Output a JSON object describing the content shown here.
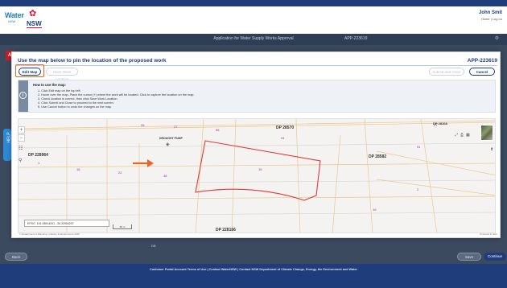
{
  "header": {
    "logo_water": "Water",
    "logo_water_sub": "NSW",
    "logo_nsw": "NSW",
    "user_name": "John Smit",
    "user_links": "Home | Log ou"
  },
  "navbar": {
    "title": "Application for Water Supply Works Approval",
    "app_ref": "APP-223619"
  },
  "modal": {
    "title": "Use the map below to pin the location of the proposed work",
    "app_id": "APP-223619",
    "buttons": {
      "edit_map": "Edit Map",
      "store_location": "Store Work Location",
      "submit_close": "Submit and Close",
      "cancel": "Cancel"
    },
    "howto": {
      "title": "How to use the map:",
      "steps": [
        "1. Click Edit map on the top left.",
        "2. Hover over the map. Place the cursor (+) where the work will be located. Click to capture the location on the map.",
        "3. Check location is correct, then click Save Work Location.",
        "4. Click Submit and Close to proceed to the next screen.",
        "5. Use Cancel button to undo the changes on the map."
      ]
    }
  },
  "map": {
    "lots": [
      {
        "label": "26"
      },
      {
        "label": "27"
      },
      {
        "label": "96"
      },
      {
        "label": "24"
      },
      {
        "label": "15"
      },
      {
        "label": "51"
      },
      {
        "label": "27"
      },
      {
        "label": "1"
      },
      {
        "label": "2"
      },
      {
        "label": "16"
      },
      {
        "label": "22"
      },
      {
        "label": "48"
      },
      {
        "label": "19"
      }
    ],
    "dp_labels": [
      "DP 28570",
      "DP 228964",
      "DP 28582",
      "DP 228166",
      "DP 28108"
    ],
    "pump_label": "DROUGHT PUMP",
    "coord_text": "151.08914201, -34.32954207",
    "coord_unit": "EPSG",
    "scale": "50 m",
    "copyright": "© Department of Planning, Industry & Environment 2020",
    "powered_by": "Powered by Esri",
    "accent_polygon_color": "#e53935"
  },
  "footer": {
    "back": "Back",
    "save": "Save",
    "continue": "Continue",
    "below_label": "DB",
    "links": "Customer Portal Account Terms of Use | Contact WaterNSW | Contact NSW Department of Climate Change, Energy, the Environment and Water"
  },
  "colors": {
    "brand_navy": "#1e3d7a",
    "accent_orange": "#e8652a",
    "nsw_red": "#d7153a"
  }
}
